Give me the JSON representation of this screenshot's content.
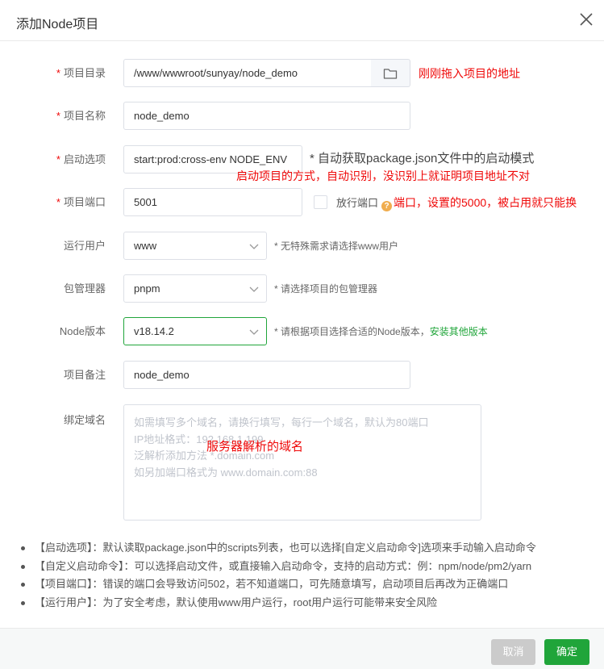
{
  "dialog": {
    "title": "添加Node项目"
  },
  "form": {
    "dir": {
      "label": "项目目录",
      "value": "/www/wwwroot/sunyay/node_demo",
      "annotation": "刚刚拖入项目的地址"
    },
    "name": {
      "label": "项目名称",
      "value": "node_demo"
    },
    "start": {
      "label": "启动选项",
      "value": "start:prod:cross-env NODE_ENV",
      "hint": "* 自动获取package.json文件中的启动模式",
      "annotation": "启动项目的方式，自动识别，没识别上就证明项目地址不对"
    },
    "port": {
      "label": "项目端口",
      "value": "5001",
      "checkbox_label": "放行端口",
      "help_icon": "?",
      "annotation": "端口，设置的5000，被占用就只能换"
    },
    "user": {
      "label": "运行用户",
      "value": "www",
      "hint": "* 无特殊需求请选择www用户"
    },
    "pkg": {
      "label": "包管理器",
      "value": "pnpm",
      "hint": "* 请选择项目的包管理器"
    },
    "node": {
      "label": "Node版本",
      "value": "v18.14.2",
      "hint": "* 请根据项目选择合适的Node版本，",
      "link": "安装其他版本"
    },
    "remark": {
      "label": "项目备注",
      "value": "node_demo"
    },
    "domain": {
      "label": "绑定域名",
      "placeholder_lines": [
        "如需填写多个域名，请换行填写，每行一个域名，默认为80端口",
        "IP地址格式：192.168.1.199",
        "泛解析添加方法 *.domain.com",
        "如另加端口格式为 www.domain.com:88"
      ],
      "annotation": "服务器解析的域名"
    }
  },
  "help": [
    "【启动选项】：默认读取package.json中的scripts列表，也可以选择[自定义启动命令]选项来手动输入启动命令",
    "【自定义启动命令】：可以选择启动文件，或直接输入启动命令，支持的启动方式：例：npm/node/pm2/yarn",
    "【项目端口】：错误的端口会导致访问502，若不知道端口，可先随意填写，启动项目后再改为正确端口",
    "【运行用户】：为了安全考虑，默认使用www用户运行，root用户运行可能带来安全风险"
  ],
  "footer": {
    "cancel": "取消",
    "confirm": "确定"
  },
  "colors": {
    "accent": "#20a53a",
    "required": "#ef0808",
    "border": "#dcdfe6"
  }
}
